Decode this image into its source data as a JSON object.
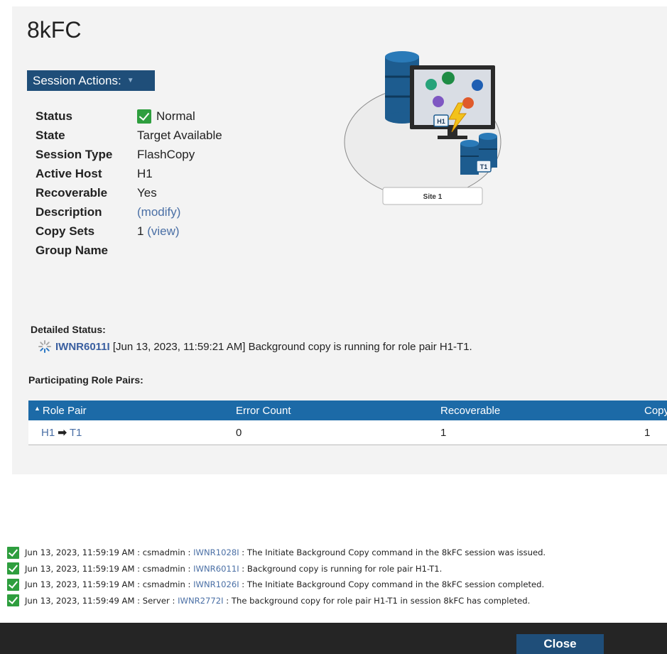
{
  "session": {
    "title": "8kFC",
    "actions_label": "Session Actions:"
  },
  "properties": [
    {
      "label": "Status",
      "value": "Normal"
    },
    {
      "label": "State",
      "value": "Target Available"
    },
    {
      "label": "Session Type",
      "value": "FlashCopy"
    },
    {
      "label": "Active Host",
      "value": "H1"
    },
    {
      "label": "Recoverable",
      "value": "Yes"
    },
    {
      "label": "Description",
      "value": "(modify)"
    },
    {
      "label": "Copy Sets",
      "value": "1",
      "link": "(view)"
    },
    {
      "label": "Group Name",
      "value": ""
    }
  ],
  "illustration": {
    "site_label": "Site 1",
    "host_badge": "H1",
    "target_badge": "T1"
  },
  "detailed_status": {
    "label": "Detailed Status:",
    "code": "IWNR6011I",
    "message": " [Jun 13, 2023, 11:59:21 AM] Background copy is running for role pair H1-T1."
  },
  "role_pairs": {
    "label": "Participating Role Pairs:",
    "columns": [
      "Role Pair",
      "Error Count",
      "Recoverable",
      "Copy"
    ],
    "rows": [
      {
        "from": "H1",
        "to": "T1",
        "error_count": "0",
        "recoverable": "1",
        "copy": "1"
      }
    ]
  },
  "log": [
    {
      "prefix": "Jun 13, 2023, 11:59:19 AM : csmadmin : ",
      "code": "IWNR1028I",
      "message": " : The Initiate Background Copy command in the 8kFC session was issued."
    },
    {
      "prefix": "Jun 13, 2023, 11:59:19 AM : csmadmin : ",
      "code": "IWNR6011I",
      "message": " : Background copy is running for role pair H1-T1."
    },
    {
      "prefix": "Jun 13, 2023, 11:59:19 AM : csmadmin : ",
      "code": "IWNR1026I",
      "message": " : The Initiate Background Copy command in the 8kFC session completed."
    },
    {
      "prefix": "Jun 13, 2023, 11:59:49 AM : Server : ",
      "code": "IWNR2772I",
      "message": " : The background copy for role pair H1-T1 in session 8kFC has completed."
    }
  ],
  "footer": {
    "close_label": "Close"
  },
  "colors": {
    "accent": "#1f4e79",
    "table_header": "#1c6aa7",
    "success": "#2e9e3e",
    "link": "#4a6fa5",
    "footer": "#252525"
  }
}
